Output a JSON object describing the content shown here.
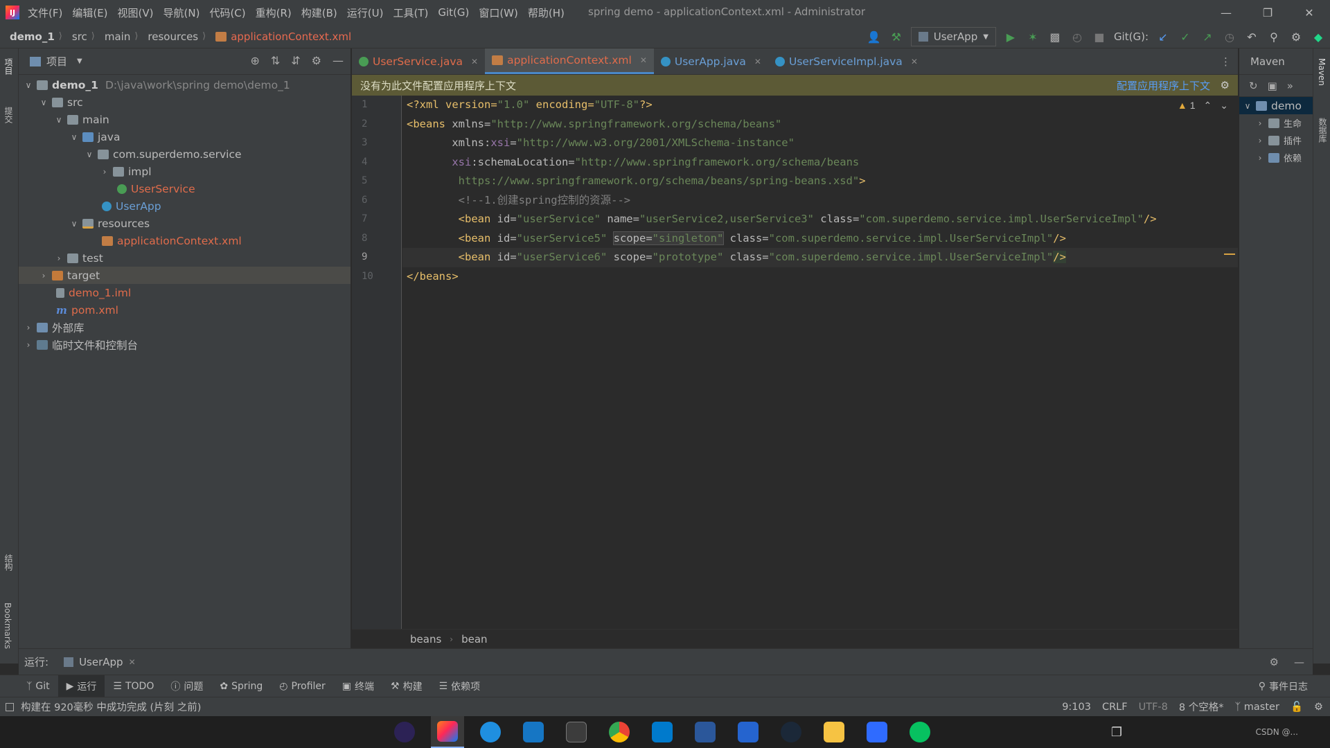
{
  "titlebar": {
    "menu": [
      "文件(F)",
      "编辑(E)",
      "视图(V)",
      "导航(N)",
      "代码(C)",
      "重构(R)",
      "构建(B)",
      "运行(U)",
      "工具(T)",
      "Git(G)",
      "窗口(W)",
      "帮助(H)"
    ],
    "title": "spring demo - applicationContext.xml - Administrator"
  },
  "breadcrumb": [
    "demo_1",
    "src",
    "main",
    "resources",
    "applicationContext.xml"
  ],
  "run_config": "UserApp",
  "git_label": "Git(G):",
  "project_panel": {
    "title": "项目",
    "root_name": "demo_1",
    "root_path": "D:\\java\\work\\spring demo\\demo_1",
    "nodes": {
      "src": "src",
      "main": "main",
      "java": "java",
      "pkg": "com.superdemo.service",
      "impl": "impl",
      "userservice": "UserService",
      "userapp": "UserApp",
      "resources": "resources",
      "appctx": "applicationContext.xml",
      "test": "test",
      "target": "target",
      "iml": "demo_1.iml",
      "pom": "pom.xml",
      "extlib": "外部库",
      "scratch": "临时文件和控制台"
    }
  },
  "editor_tabs": [
    {
      "label": "UserService.java"
    },
    {
      "label": "applicationContext.xml"
    },
    {
      "label": "UserApp.java"
    },
    {
      "label": "UserServiceImpl.java"
    }
  ],
  "banner": {
    "message": "没有为此文件配置应用程序上下文",
    "action": "配置应用程序上下文"
  },
  "warnings_count": "1",
  "code": {
    "line_numbers": [
      "1",
      "2",
      "3",
      "4",
      "5",
      "6",
      "7",
      "8",
      "9",
      "10"
    ],
    "l1_a": "<?xml version=",
    "l1_b": "\"1.0\"",
    "l1_c": " encoding=",
    "l1_d": "\"UTF-8\"",
    "l1_e": "?>",
    "l2_a": "<beans",
    "l2_b": " xmlns=",
    "l2_c": "\"http://www.springframework.org/schema/beans\"",
    "l3_a": "       xmlns:",
    "l3_b": "xsi",
    "l3_c": "=",
    "l3_d": "\"http://www.w3.org/2001/XMLSchema-instance\"",
    "l4_a": "       ",
    "l4_b": "xsi",
    "l4_c": ":schemaLocation=",
    "l4_d": "\"http://www.springframework.org/schema/beans",
    "l5": "        https://www.springframework.org/schema/beans/spring-beans.xsd\"",
    "l5_end": ">",
    "l6": "        <!--1.创建spring控制的资源-->",
    "l7_a": "        <bean",
    "l7_b": " id=",
    "l7_c": "\"userService\"",
    "l7_d": " name=",
    "l7_e": "\"userService2,userService3\"",
    "l7_f": " class=",
    "l7_g": "\"com.superdemo.service.impl.UserServiceImpl\"",
    "l7_h": "/>",
    "l8_a": "        <bean",
    "l8_b": " id=",
    "l8_c": "\"userService5\"",
    "l8_d": "scope=",
    "l8_e": "\"singleton\"",
    "l8_f": " class=",
    "l8_g": "\"com.superdemo.service.impl.UserServiceImpl\"",
    "l8_h": "/>",
    "l9_a": "        <bean",
    "l9_b": " id=",
    "l9_c": "\"userService6\"",
    "l9_d": " scope=",
    "l9_e": "\"prototype\"",
    "l9_f": " class=",
    "l9_g": "\"com.superdemo.service.impl.UserServiceImpl\"",
    "l9_h": "/>",
    "l10": "</beans>"
  },
  "editor_breadcrumb": [
    "beans",
    "bean"
  ],
  "maven": {
    "title": "Maven",
    "root": "demo",
    "children": [
      "生命",
      "插件",
      "依赖"
    ]
  },
  "left_strip": {
    "project": "项目",
    "commit": "提交",
    "structure": "结构",
    "bookmarks": "Bookmarks"
  },
  "right_strip": {
    "maven": "Maven",
    "db": "数据库"
  },
  "run_bar": {
    "label": "运行:",
    "tab": "UserApp"
  },
  "tool_tabs": [
    "Git",
    "运行",
    "TODO",
    "问题",
    "Spring",
    "Profiler",
    "终端",
    "构建",
    "依赖项"
  ],
  "event_log": "事件日志",
  "status": {
    "message": "构建在 920毫秒 中成功完成 (片刻 之前)",
    "position": "9:103",
    "line_sep": "CRLF",
    "encoding": "UTF-8",
    "indent": "8 个空格*",
    "branch": "master"
  },
  "taskbar": {
    "watermark": "CSDN @..."
  }
}
